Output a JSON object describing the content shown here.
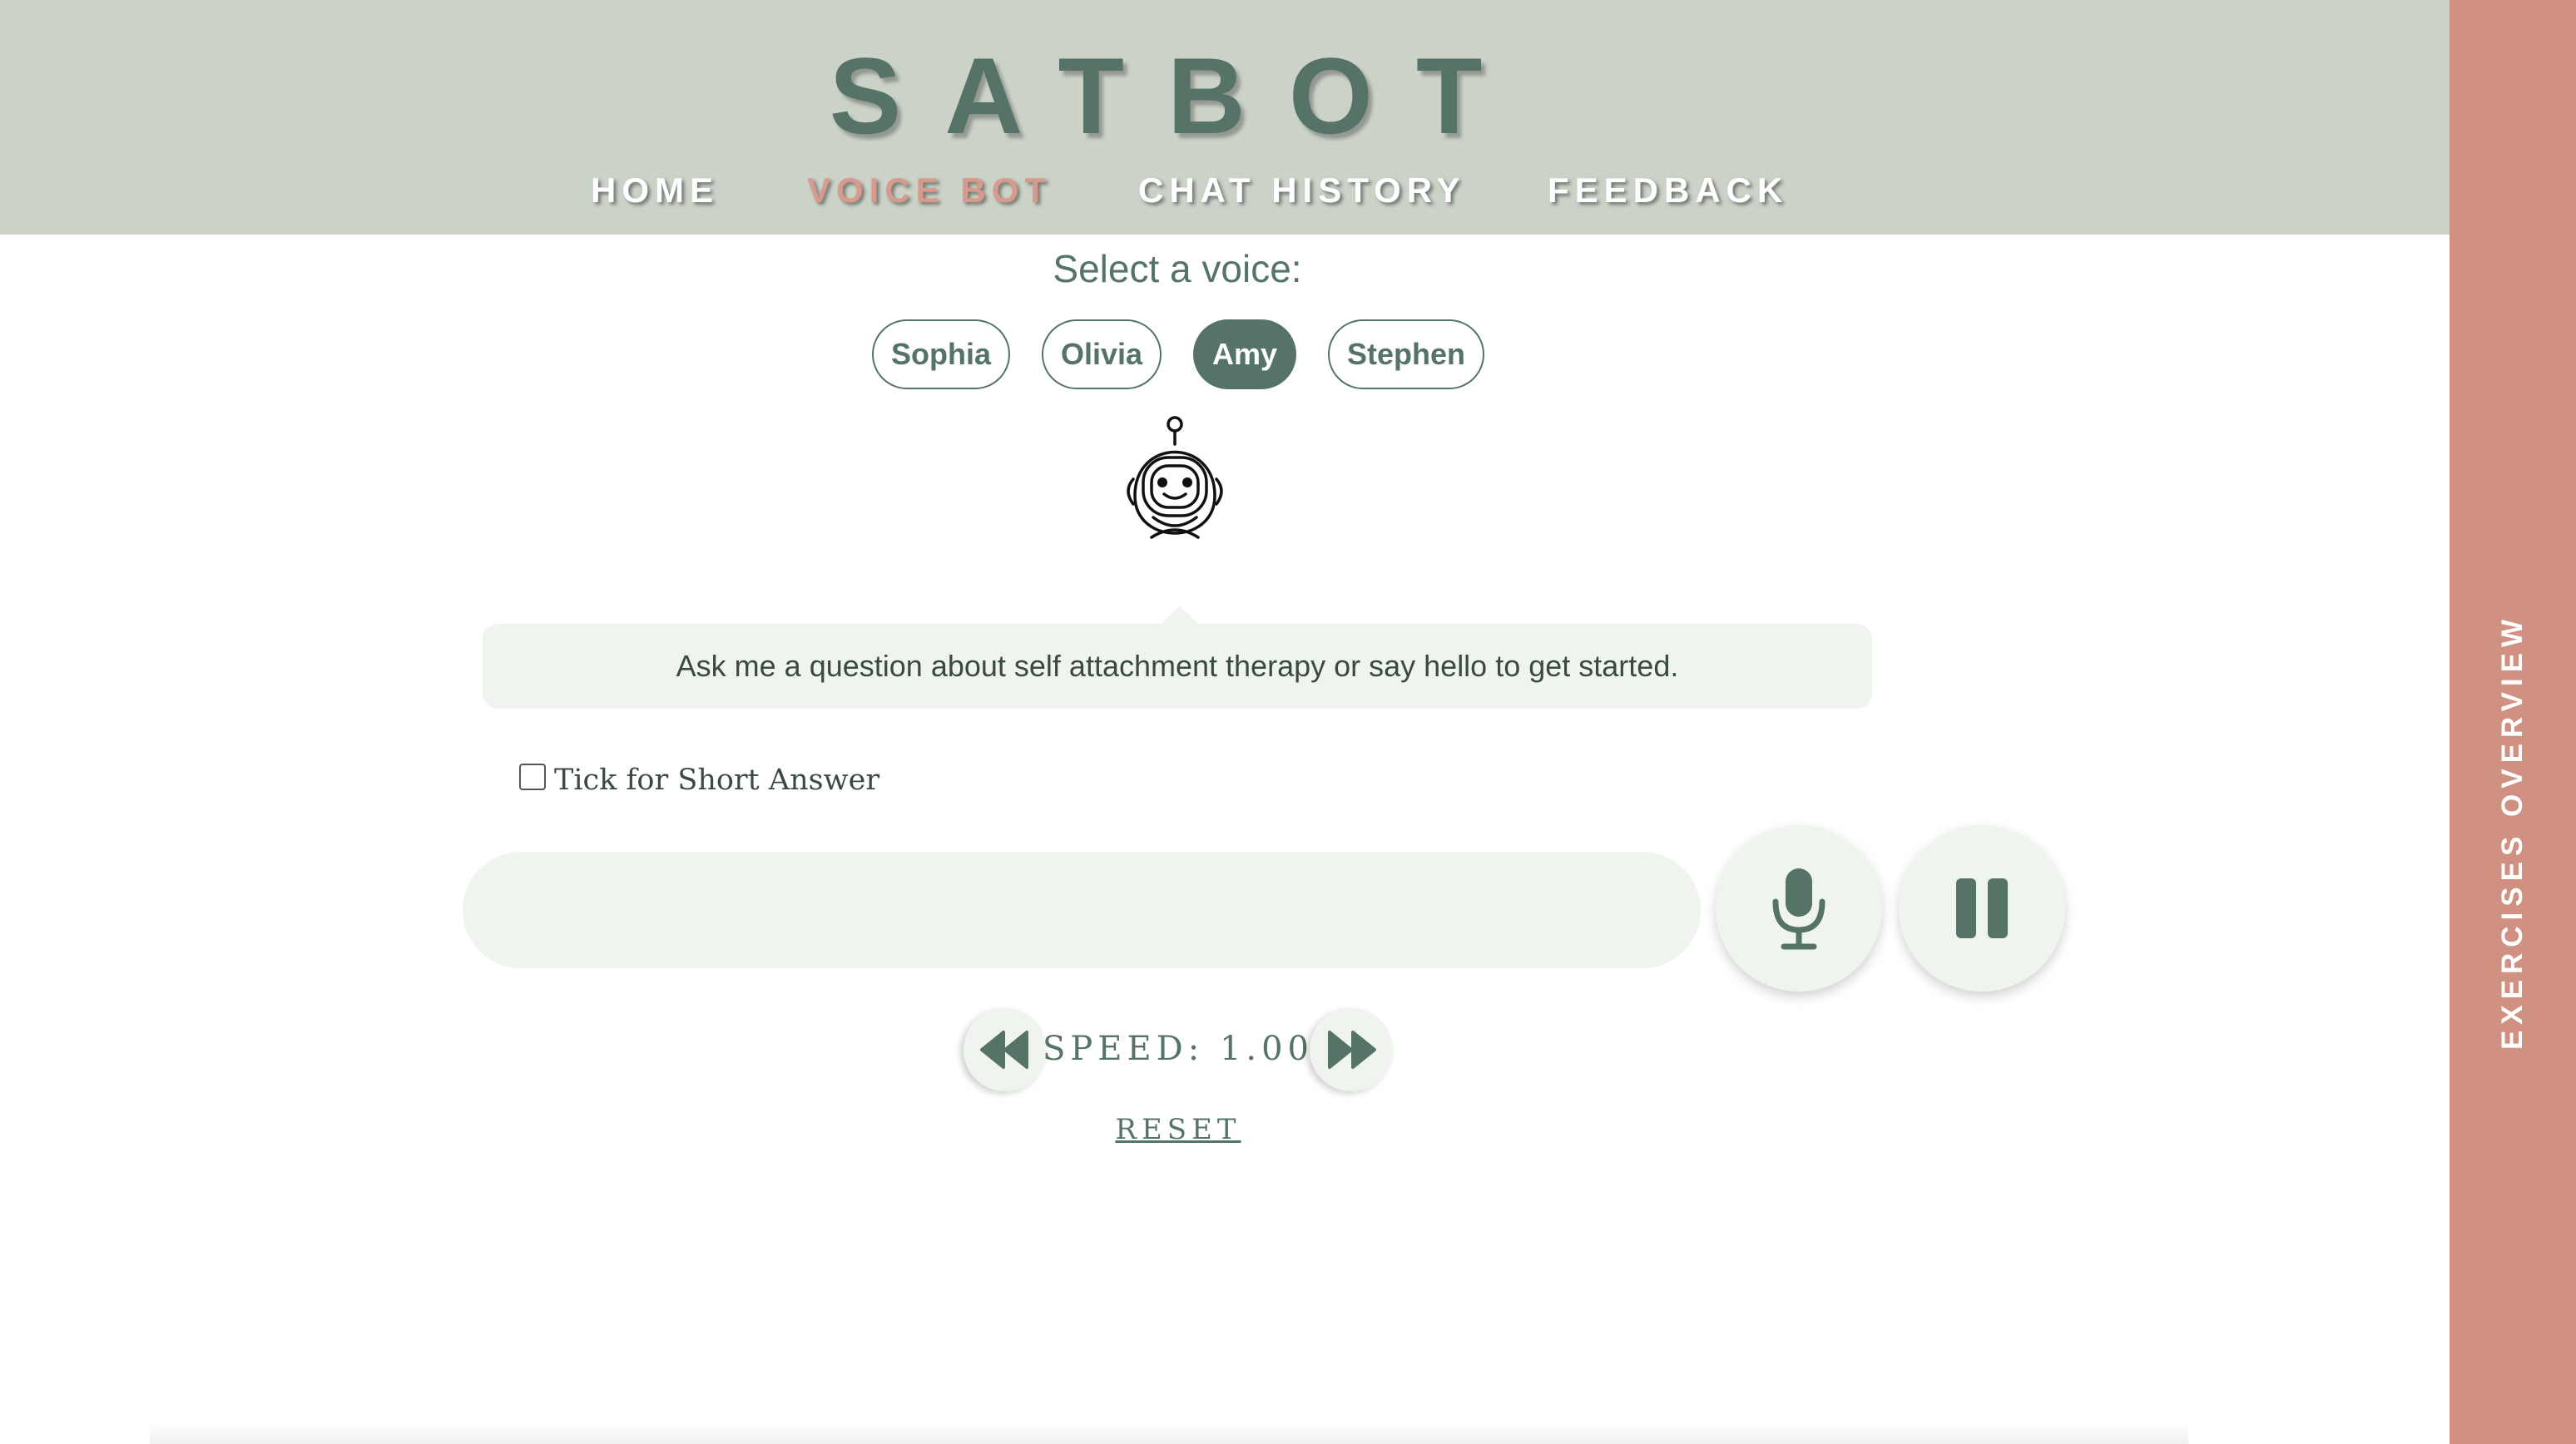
{
  "header": {
    "logo": "SATBOT",
    "nav": [
      {
        "label": "HOME"
      },
      {
        "label": "VOICE BOT",
        "active": true
      },
      {
        "label": "CHAT HISTORY"
      },
      {
        "label": "FEEDBACK"
      }
    ]
  },
  "sidebar": {
    "label": "EXERCISES OVERVIEW"
  },
  "voice_select": {
    "label": "Select a voice:",
    "voices": [
      "Sophia",
      "Olivia",
      "Amy",
      "Stephen"
    ],
    "selected": "Amy"
  },
  "bot": {
    "avatar_icon": "robot-icon",
    "message": "Ask me a question about self attachment therapy or say hello to get started."
  },
  "short_answer": {
    "label": "Tick for Short Answer",
    "checked": false
  },
  "input": {
    "value": "",
    "placeholder": ""
  },
  "controls": {
    "mic_icon": "microphone-icon",
    "pause_icon": "pause-icon"
  },
  "speed": {
    "label": "SPEED: 1.00",
    "value": 1.0,
    "slower_icon": "rewind-icon",
    "faster_icon": "fast-forward-icon",
    "reset_label": "RESET"
  },
  "colors": {
    "header_bg": "#cbd3c8",
    "accent": "#557366",
    "active_nav": "#d79a8c",
    "sidebar_bg": "#d09082",
    "panel_bg": "#f0f4ee"
  }
}
